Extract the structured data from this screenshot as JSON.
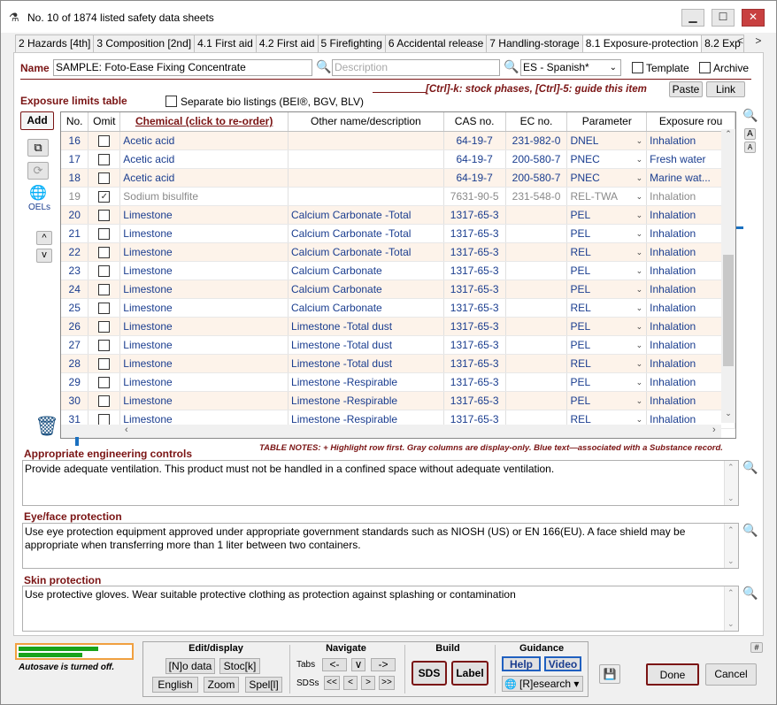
{
  "window": {
    "title": "No. 10 of 1874 listed safety data sheets",
    "minimize": "▁",
    "maximize": "☐",
    "close": "✕",
    "app_icon": "flask-icon"
  },
  "tabs": [
    "2 Hazards [4th]",
    "3 Composition [2nd]",
    "4.1 First aid",
    "4.2 First aid",
    "5 Firefighting",
    "6 Accidental release",
    "7 Handling-storage",
    "8.1 Exposure-protection",
    "8.2 Exp"
  ],
  "tab_nav": {
    "prev": "<",
    "next": ">"
  },
  "name_row": {
    "label": "Name",
    "value": "SAMPLE: Foto-Ease Fixing Concentrate",
    "description_placeholder": "Description",
    "language": "ES - Spanish*",
    "template_label": "Template",
    "archive_label": "Archive"
  },
  "exposure": {
    "title": "Exposure limits table",
    "separate_bio": "Separate bio listings (BEI®, BGV, BLV)",
    "hint": "[Ctrl]-k: stock phases, [Ctrl]-5: guide this item",
    "paste": "Paste",
    "link": "Link",
    "add": "Add",
    "oels": "OELs",
    "up": "^",
    "down": "v"
  },
  "table": {
    "headers": [
      "No.",
      "Omit",
      "Chemical (click to re-order)",
      "Other name/description",
      "CAS no.",
      "EC no.",
      "Parameter",
      "Exposure rou"
    ],
    "rows": [
      {
        "no": "16",
        "omit": false,
        "chemical": "Acetic acid",
        "other": "",
        "cas": "64-19-7",
        "ec": "231-982-0",
        "param": "DNEL",
        "route": "Inhalation",
        "style": "alt"
      },
      {
        "no": "17",
        "omit": false,
        "chemical": "Acetic acid",
        "other": "",
        "cas": "64-19-7",
        "ec": "200-580-7",
        "param": "PNEC",
        "route": "Fresh water",
        "style": ""
      },
      {
        "no": "18",
        "omit": false,
        "chemical": "Acetic acid",
        "other": "",
        "cas": "64-19-7",
        "ec": "200-580-7",
        "param": "PNEC",
        "route": "Marine wat...",
        "style": "alt"
      },
      {
        "no": "19",
        "omit": true,
        "chemical": "Sodium bisulfite",
        "other": "",
        "cas": "7631-90-5",
        "ec": "231-548-0",
        "param": "REL-TWA",
        "route": "Inhalation",
        "style": "gray"
      },
      {
        "no": "20",
        "omit": false,
        "chemical": "Limestone",
        "other": "Calcium Carbonate -Total",
        "cas": "1317-65-3",
        "ec": "",
        "param": "PEL",
        "route": "Inhalation",
        "style": "alt"
      },
      {
        "no": "21",
        "omit": false,
        "chemical": "Limestone",
        "other": "Calcium Carbonate -Total",
        "cas": "1317-65-3",
        "ec": "",
        "param": "PEL",
        "route": "Inhalation",
        "style": ""
      },
      {
        "no": "22",
        "omit": false,
        "chemical": "Limestone",
        "other": "Calcium Carbonate -Total",
        "cas": "1317-65-3",
        "ec": "",
        "param": "REL",
        "route": "Inhalation",
        "style": "alt"
      },
      {
        "no": "23",
        "omit": false,
        "chemical": "Limestone",
        "other": "Calcium Carbonate",
        "cas": "1317-65-3",
        "ec": "",
        "param": "PEL",
        "route": "Inhalation",
        "style": ""
      },
      {
        "no": "24",
        "omit": false,
        "chemical": "Limestone",
        "other": "Calcium Carbonate",
        "cas": "1317-65-3",
        "ec": "",
        "param": "PEL",
        "route": "Inhalation",
        "style": "alt"
      },
      {
        "no": "25",
        "omit": false,
        "chemical": "Limestone",
        "other": "Calcium Carbonate",
        "cas": "1317-65-3",
        "ec": "",
        "param": "REL",
        "route": "Inhalation",
        "style": ""
      },
      {
        "no": "26",
        "omit": false,
        "chemical": "Limestone",
        "other": "Limestone -Total dust",
        "cas": "1317-65-3",
        "ec": "",
        "param": "PEL",
        "route": "Inhalation",
        "style": "alt"
      },
      {
        "no": "27",
        "omit": false,
        "chemical": "Limestone",
        "other": "Limestone -Total dust",
        "cas": "1317-65-3",
        "ec": "",
        "param": "PEL",
        "route": "Inhalation",
        "style": ""
      },
      {
        "no": "28",
        "omit": false,
        "chemical": "Limestone",
        "other": "Limestone -Total dust",
        "cas": "1317-65-3",
        "ec": "",
        "param": "REL",
        "route": "Inhalation",
        "style": "alt"
      },
      {
        "no": "29",
        "omit": false,
        "chemical": "Limestone",
        "other": "Limestone -Respirable",
        "cas": "1317-65-3",
        "ec": "",
        "param": "PEL",
        "route": "Inhalation",
        "style": ""
      },
      {
        "no": "30",
        "omit": false,
        "chemical": "Limestone",
        "other": "Limestone -Respirable",
        "cas": "1317-65-3",
        "ec": "",
        "param": "PEL",
        "route": "Inhalation",
        "style": "alt"
      },
      {
        "no": "31",
        "omit": false,
        "chemical": "Limestone",
        "other": "Limestone -Respirable",
        "cas": "1317-65-3",
        "ec": "",
        "param": "REL",
        "route": "Inhalation",
        "style": ""
      }
    ],
    "notes": "TABLE NOTES: + Highlight row first. Gray columns are display-only. Blue text—associated with a Substance record."
  },
  "engineering": {
    "title": "Appropriate engineering controls",
    "text": "Provide adequate ventilation. This product must not be handled in a confined space without adequate ventilation."
  },
  "eye": {
    "title": "Eye/face protection",
    "text": "Use eye protection equipment approved under appropriate government standards such as NIOSH (US) or EN 166(EU). A face shield may be appropriate when transferring more than 1 liter between two containers."
  },
  "skin": {
    "title": "Skin protection",
    "text": "Use protective gloves. Wear suitable protective clothing as protection against splashing or contamination"
  },
  "bottom": {
    "autosave": "Autosave is turned off.",
    "edit_display": {
      "title": "Edit/display",
      "no_data": "[N]o data",
      "stock": "Stoc[k]",
      "english": "English",
      "zoom": "Zoom",
      "spell": "Spel[l]"
    },
    "navigate": {
      "title": "Navigate",
      "tabs_label": "Tabs",
      "sdss_label": "SDSs",
      "tab_prev": "<-",
      "tab_menu": "∨",
      "tab_next": "->",
      "first": "<<",
      "prev": "<",
      "next": ">",
      "last": ">>"
    },
    "build": {
      "title": "Build",
      "sds": "SDS",
      "label": "Label"
    },
    "guidance": {
      "title": "Guidance",
      "help": "Help",
      "video": "Video",
      "research": "[R]esearch ▾"
    },
    "done": "Done",
    "cancel": "Cancel",
    "hash": "#"
  },
  "colors": {
    "accent": "#7a1414",
    "link": "#1a3d8f",
    "autosave_border": "#f0a040",
    "progress": "#1aa31a"
  }
}
